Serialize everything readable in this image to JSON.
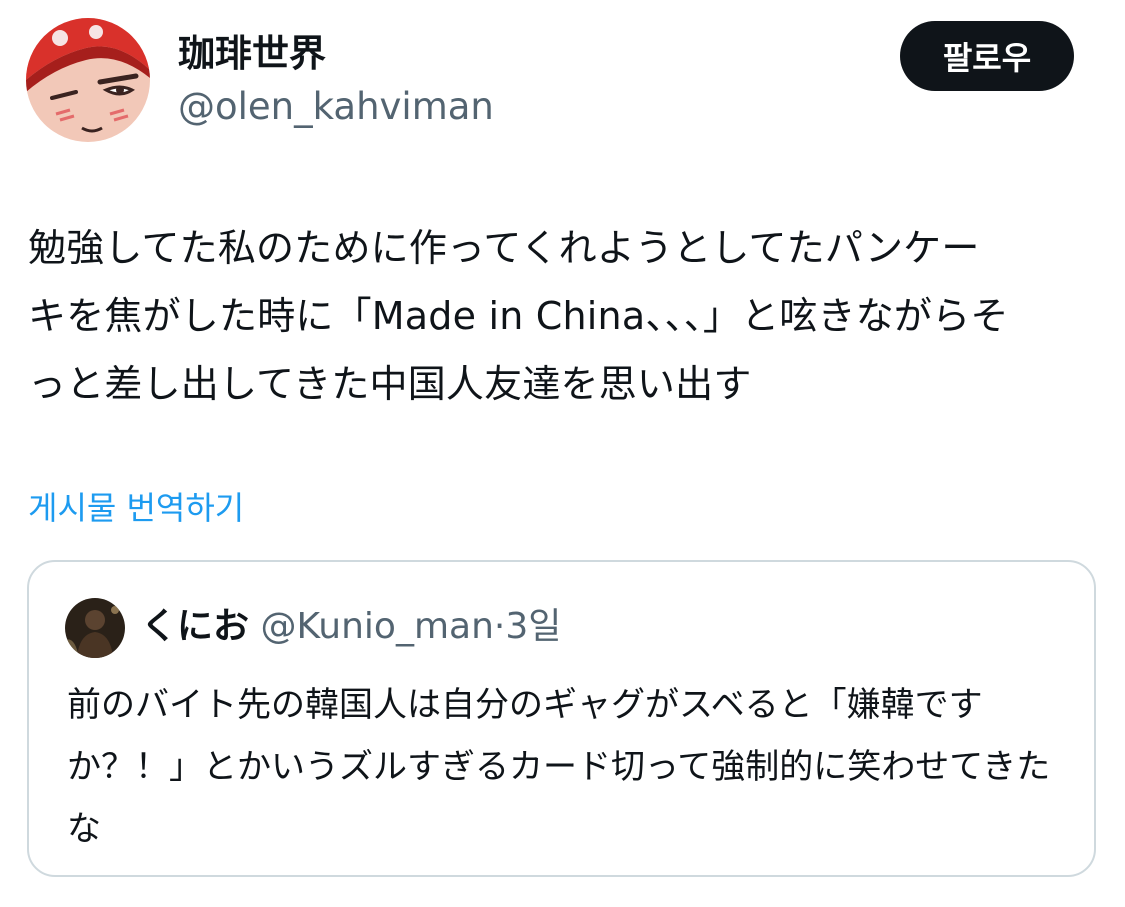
{
  "author": {
    "display_name": "珈琲世界",
    "handle": "@olen_kahviman",
    "avatar_icon": "anime-character-avatar"
  },
  "follow_label": "팔로우",
  "tweet": {
    "text": "勉強してた私のために作ってくれようとしてたパンケー\nキを焦がした時に「Made in China、、、」と呟きながらそ\nっと差し出してきた中国人友達を思い出す"
  },
  "translate_label": "게시물 번역하기",
  "quoted_tweet": {
    "display_name": "くにお",
    "handle": "@Kunio_man",
    "separator": "·",
    "time": "3일",
    "text": "前のバイト先の韓国人は自分のギャグがスベると「嫌韓ですか？！」とかいうズルすぎるカード切って強制的に笑わせてきたな",
    "avatar_icon": "dark-photo-avatar"
  },
  "colors": {
    "text_primary": "#0f1419",
    "text_secondary": "#536471",
    "link": "#1d9bf0",
    "border": "#cfd9de",
    "button_bg": "#0f1419"
  }
}
